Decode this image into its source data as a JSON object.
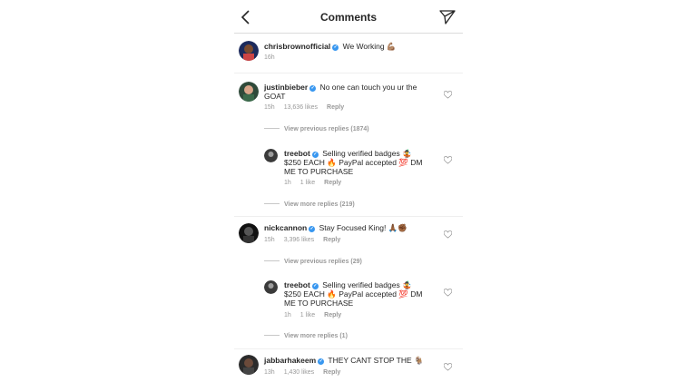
{
  "header": {
    "title": "Comments"
  },
  "icons": {
    "back": "chevron-left-icon",
    "send": "paper-plane-icon",
    "like": "heart-outline-icon",
    "verified": "verified-badge-icon"
  },
  "caption": {
    "username": "chrisbrownofficial",
    "text": "We Working 💪🏽",
    "time": "16h"
  },
  "comments": [
    {
      "username": "justinbieber",
      "text": "No one can touch you ur the GOAT",
      "time": "15h",
      "likes": "13,636 likes",
      "reply": "Reply",
      "view_previous": "View previous replies (1874)",
      "reply_item": {
        "username": "treebot",
        "text": "Selling verified badges 🤹 $250 EACH 🔥 PayPal accepted 💯 DM ME TO PURCHASE",
        "time": "1h",
        "likes": "1 like",
        "reply": "Reply"
      },
      "view_more": "View more replies (219)"
    },
    {
      "username": "nickcannon",
      "text": "Stay Focused King! 🙏🏾✊🏾",
      "time": "15h",
      "likes": "3,396 likes",
      "reply": "Reply",
      "view_previous": "View previous replies (29)",
      "reply_item": {
        "username": "treebot",
        "text": "Selling verified badges 🤹 $250 EACH 🔥 PayPal accepted 💯 DM ME TO PURCHASE",
        "time": "1h",
        "likes": "1 like",
        "reply": "Reply"
      },
      "view_more": "View more replies (1)"
    },
    {
      "username": "jabbarhakeem",
      "text": "THEY CANT STOP THE 🐐",
      "time": "13h",
      "likes": "1,430 likes",
      "reply": "Reply"
    }
  ]
}
